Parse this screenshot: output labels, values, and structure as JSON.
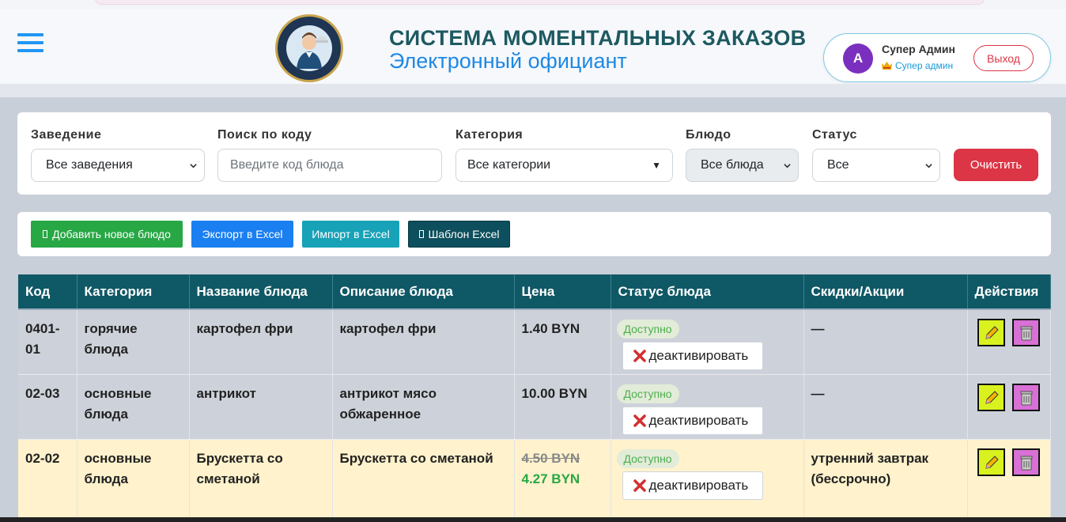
{
  "header": {
    "title": "СИСТЕМА МОМЕНТАЛЬНЫХ ЗАКАЗОВ",
    "subtitle": "Электронный официант",
    "logo_text": "ЭЛЕКТРОННЫЙ ОФИЦИАНТ",
    "user": {
      "avatar_letter": "A",
      "name": "Супер Админ",
      "role": "Супер админ",
      "logout_label": "Выход"
    }
  },
  "filters": {
    "establishment": {
      "label": "Заведение",
      "value": "Все заведения"
    },
    "code_search": {
      "label": "Поиск по коду",
      "placeholder": "Введите код блюда"
    },
    "category": {
      "label": "Категория",
      "value": "Все категории"
    },
    "dish": {
      "label": "Блюдо",
      "value": "Все блюда"
    },
    "status": {
      "label": "Статус",
      "value": "Все"
    },
    "clear_label": "Очистить"
  },
  "actions": {
    "add_label": "Добавить новое блюдо",
    "export_label": "Экспорт в Excel",
    "import_label": "Импорт в Excel",
    "template_label": "Шаблон Excel"
  },
  "table": {
    "columns": [
      "Код",
      "Категория",
      "Название блюда",
      "Описание блюда",
      "Цена",
      "Статус блюда",
      "Скидки/Акции",
      "Действия"
    ],
    "rows": [
      {
        "code": "0401-01",
        "category": "горячие блюда",
        "name": "картофел фри",
        "description": "картофел фри",
        "price": "1.40 BYN",
        "status": "Доступно",
        "deactivate_label": "деактивировать",
        "discount": "—"
      },
      {
        "code": "02-03",
        "category": "основные блюда",
        "name": "антрикот",
        "description": "антрикот мясо обжаренное",
        "price": "10.00 BYN",
        "status": "Доступно",
        "deactivate_label": "деактивировать",
        "discount": "—"
      },
      {
        "code": "02-02",
        "category": "основные блюда",
        "name": "Брускетта со сметаной",
        "description": "Брускетта со сметаной",
        "old_price": "4.50 BYN",
        "price": "4.27 BYN",
        "status": "Доступно",
        "deactivate_label": "деактивировать",
        "discount": "утренний завтрак (бессрочно)"
      }
    ]
  },
  "colors": {
    "header_table": "#0f5866",
    "title": "#1d5961",
    "subtitle": "#1e88e5",
    "add_button": "#28a745",
    "export_button": "#1a7ff0",
    "import_button": "#17a2b8",
    "template_button": "#0d4f5c",
    "clear_button": "#dc3545",
    "edit_button": "#d9f21f",
    "delete_button": "#d870d6",
    "discount_row": "#fff2cc"
  }
}
